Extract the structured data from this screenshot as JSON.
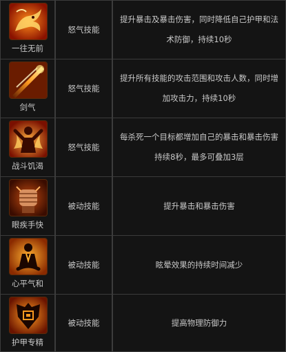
{
  "skills": [
    {
      "name": "一往无前",
      "type": "怒气技能",
      "description": "提升暴击及暴击伤害，同时降低自己护甲和法术防御，持续10秒",
      "icon": "dragon-icon"
    },
    {
      "name": "剑气",
      "type": "怒气技能",
      "description": "提升所有技能的攻击范围和攻击人数，同时增加攻击力，持续10秒",
      "icon": "sword-energy-icon"
    },
    {
      "name": "战斗饥渴",
      "type": "怒气技能",
      "description": "每杀死一个目标都增加自己的暴击和暴击伤害持续8秒，最多可叠加3层",
      "icon": "flame-warrior-icon"
    },
    {
      "name": "眼疾手快",
      "type": "被动技能",
      "description": "提升暴击和暴击伤害",
      "icon": "fist-icon"
    },
    {
      "name": "心平气和",
      "type": "被动技能",
      "description": "眩晕效果的持续时间减少",
      "icon": "meditation-icon"
    },
    {
      "name": "护甲专精",
      "type": "被动技能",
      "description": "提高物理防御力",
      "icon": "armor-icon"
    }
  ]
}
